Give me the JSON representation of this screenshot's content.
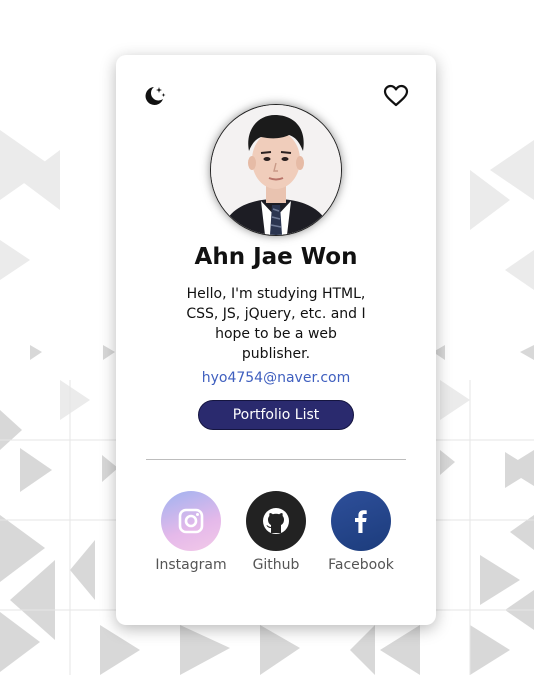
{
  "profile": {
    "name": "Ahn Jae Won",
    "bio": "Hello, I'm studying HTML, CSS, JS, jQuery, etc. and I hope to be a web publisher.",
    "email": "hyo4754@naver.com"
  },
  "actions": {
    "portfolio_label": "Portfolio List"
  },
  "header": {
    "theme_icon": "moon-stars-icon",
    "like_icon": "heart-outline-icon"
  },
  "social": [
    {
      "label": "Instagram",
      "icon": "instagram-icon",
      "color": "#c9b7ee"
    },
    {
      "label": "Github",
      "icon": "github-icon",
      "color": "#222222"
    },
    {
      "label": "Facebook",
      "icon": "facebook-icon",
      "color": "#234487"
    }
  ],
  "colors": {
    "button_bg": "#2a2a6e",
    "email": "#3f5fbf"
  }
}
